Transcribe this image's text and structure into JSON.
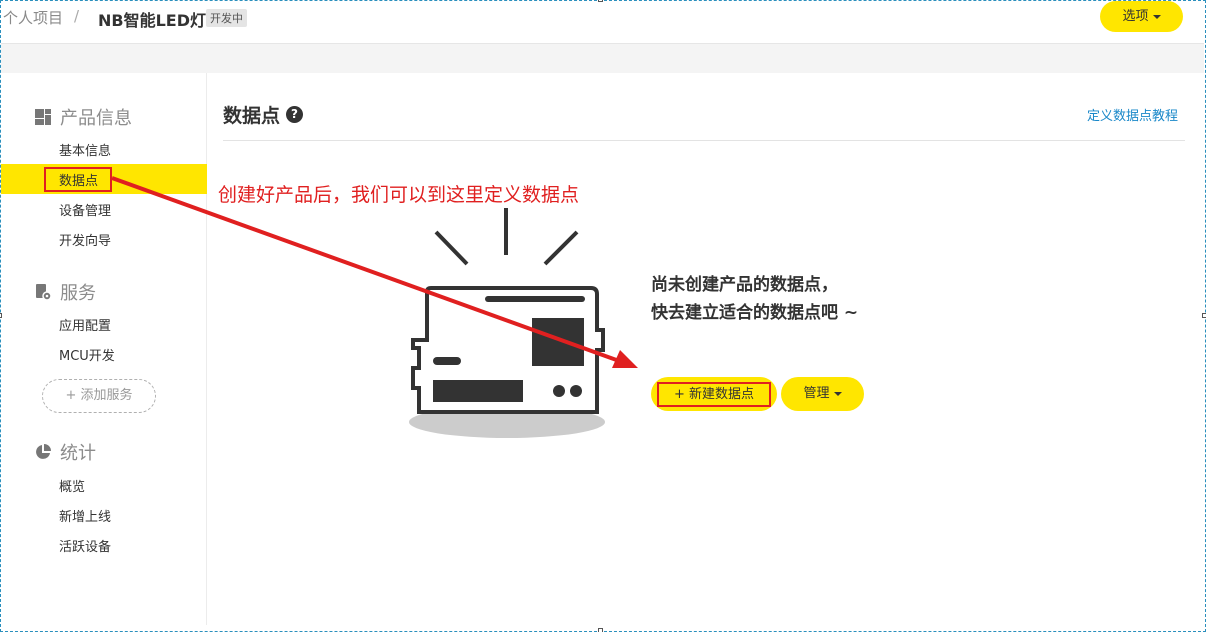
{
  "header": {
    "breadcrumb_root": "个人项目",
    "breadcrumb_sep": "/",
    "project_name": "NB智能LED灯",
    "status_badge": "开发中",
    "options_label": "选项"
  },
  "sidebar": {
    "sections": [
      {
        "title": "产品信息",
        "icon": "dashboard-icon",
        "items": [
          "基本信息",
          "数据点",
          "设备管理",
          "开发向导"
        ]
      },
      {
        "title": "服务",
        "icon": "service-gear-icon",
        "items": [
          "应用配置",
          "MCU开发"
        ],
        "add_label": "+ 添加服务"
      },
      {
        "title": "统计",
        "icon": "pie-chart-icon",
        "items": [
          "概览",
          "新增上线",
          "活跃设备"
        ]
      }
    ],
    "active_item": "数据点"
  },
  "main": {
    "title": "数据点",
    "help_icon": "question-circle-icon",
    "tutorial_link": "定义数据点教程",
    "annotation": "创建好产品后，我们可以到这里定义数据点",
    "empty_line1": "尚未创建产品的数据点，",
    "empty_line2": "快去建立适合的数据点吧 ~",
    "new_button": "+ 新建数据点",
    "manage_button": "管理",
    "illustration": "device-illustration"
  },
  "colors": {
    "accent": "#ffe600",
    "annotation_red": "#e02020",
    "link_blue": "#1a88c9"
  }
}
